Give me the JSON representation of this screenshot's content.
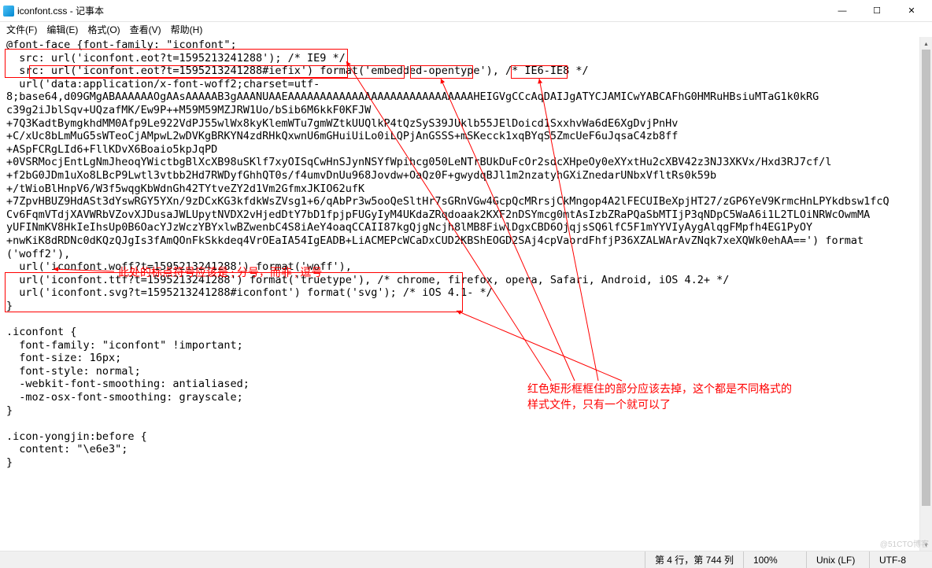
{
  "window": {
    "title": "iconfont.css - 记事本",
    "min": "—",
    "max": "☐",
    "close": "✕"
  },
  "menu": {
    "file": "文件(F)",
    "edit": "编辑(E)",
    "format": "格式(O)",
    "view": "查看(V)",
    "help": "帮助(H)"
  },
  "code": {
    "l1": "@font-face {font-family: \"iconfont\";",
    "l2": "  src: url('iconfont.eot?t=1595213241288'); /* IE9 */",
    "l3a": "  src: ",
    "l3b": "url('iconfont.eot?t=1595213241288#iefix') format('embedded-opentype'),",
    "l3c": " /* IE6-IE8 */",
    "l4": "  url('data:application/x-font-woff2;charset=utf-",
    "l5": "8;base64,d09GMgABAAAAAAOgAAsAAAAAB3gAAANUAAEAAAAAAAAAAAAAAAAAAAAAAAAAAAAAHEIGVgCCcAqDAIJgATYCJAMICwYABCAFhG0HMRuHBsiuMTaG1k0kRG",
    "l6": "c39g2iJblSqv+UQzafMK/Ew9P++M59M59MZJRW1Uo/bSib6M6kkF0KFJW",
    "l7": "+7Q3KadtBymgkhdMM0Afp9Le922VdPJ55wlWx8kyKlemWTu7gmWZtkUUQlkP4tQzSyS39JUklb55JElDoicd1SxxhvWa6dE6XgDvjPnHv",
    "l8": "+C/xUc8bLmMuG5sWTeoCjAMpwL2wDVKgBRKYN4zdRHkQxwnU6mGHuiUiLo0iLQPjAnGSSS+mSKecck1xqBYqS5ZmcUeF6uJqsaC4zb8ff",
    "l9": "+ASpFCRgLId6+FllKDvX6Boaio5kpJqPD",
    "l10": "+0VSRMocjEntLgNmJheoqYWictbgBlXcXB98uSKlf7xyOISqCwHnSJynNSYfWpihcg050LeNTrBUkDuFcOr2sdcXHpeOy0eXYxtHu2cXBV42z3NJ3XKVx/Hxd3RJ7cf/l",
    "l11": "+f2bG0JDm1uXo8LBcP9Lwtl3vtbb2Hd7RWDyfGhhQT0s/f4umvDnUu968Jovdw+OaQz0F+gwydqBJl1m2nzatyhGXiZnedarUNbxVfltRs0k59b",
    "l12": "+/tWioBlHnpV6/W3f5wqgKbWdnGh42TYtveZY2d1Vm2GfmxJKIO62ufK",
    "l13": "+7ZpvHBUZ9HdASt3dYswRGY5YXn/9zDCxKG3kfdkWsZVsg1+6/qAbPr3w5ooQeSltHr7sGRnVGw4GcpQcMRrsjCkMngop4A2lFECUIBeXpjHT27/zGP6YeV9KrmcHnLPYkdbsw1fcQ",
    "l14": "Cv6FqmVTdjXAVWRbVZovXJDusaJWLUpytNVDX2vHjedDtY7bD1fpjpFUGyIyM4UKdaZRqdoaak2KXF2nDSYmcg0mtAsIzbZRaPQaSbMTIjP3qNDpC5WaA6i1L2TLOiNRWcOwmMA",
    "l15": "yUFINmKV8HkIeIhsUp0B6OacYJzWczYBYxlwBZwenbC4S8iAeY4oaqCCAII87kgQjgNcjh8lMB8FiwlDgxCBD6OjqjsSQ6lfC5F1mYYVIyAygAlqgFMpfh4EG1PyOY",
    "l16": "+nwKiK8dRDNc0dKQzQJgIs3fAmQOnFkSkkdeq4VrOEaIA54IgEADB+LiACMEPcWCaDxCUD2KBShEOGD2SAj4cpVaordFhfjP36XZALWArAvZNqk7xeXQWk0ehAA==') format",
    "l17": "('woff2'),",
    "l18": "  url('iconfont.woff?t=1595213241288') format('woff'),",
    "l19": "  url('iconfont.ttf?t=1595213241288') format('truetype'), /* chrome, firefox, opera, Safari, Android, iOS 4.2+ */",
    "l20": "  url('iconfont.svg?t=1595213241288#iconfont') format('svg'); /* iOS 4.1- */",
    "l21": "}",
    "l22": "",
    "l23": ".iconfont {",
    "l24": "  font-family: \"iconfont\" !important;",
    "l25": "  font-size: 16px;",
    "l26": "  font-style: normal;",
    "l27": "  -webkit-font-smoothing: antialiased;",
    "l28": "  -moz-osx-font-smoothing: grayscale;",
    "l29": "}",
    "l30": "",
    "l31": ".icon-yongjin:before {",
    "l32": "  content: \"\\e6e3\";",
    "l33": "}"
  },
  "annotations": {
    "a1": "此处的标点符号应该是 ; 分号，而非 , 逗号",
    "a2": "红色矩形框框住的部分应该去掉，这个都是不同格式的",
    "a3": "样式文件，只有一个就可以了"
  },
  "status": {
    "pos": "第 4 行，第 744 列",
    "zoom": "100%",
    "eol": "Unix (LF)",
    "enc": "UTF-8"
  },
  "watermark": "@51CTO博客"
}
